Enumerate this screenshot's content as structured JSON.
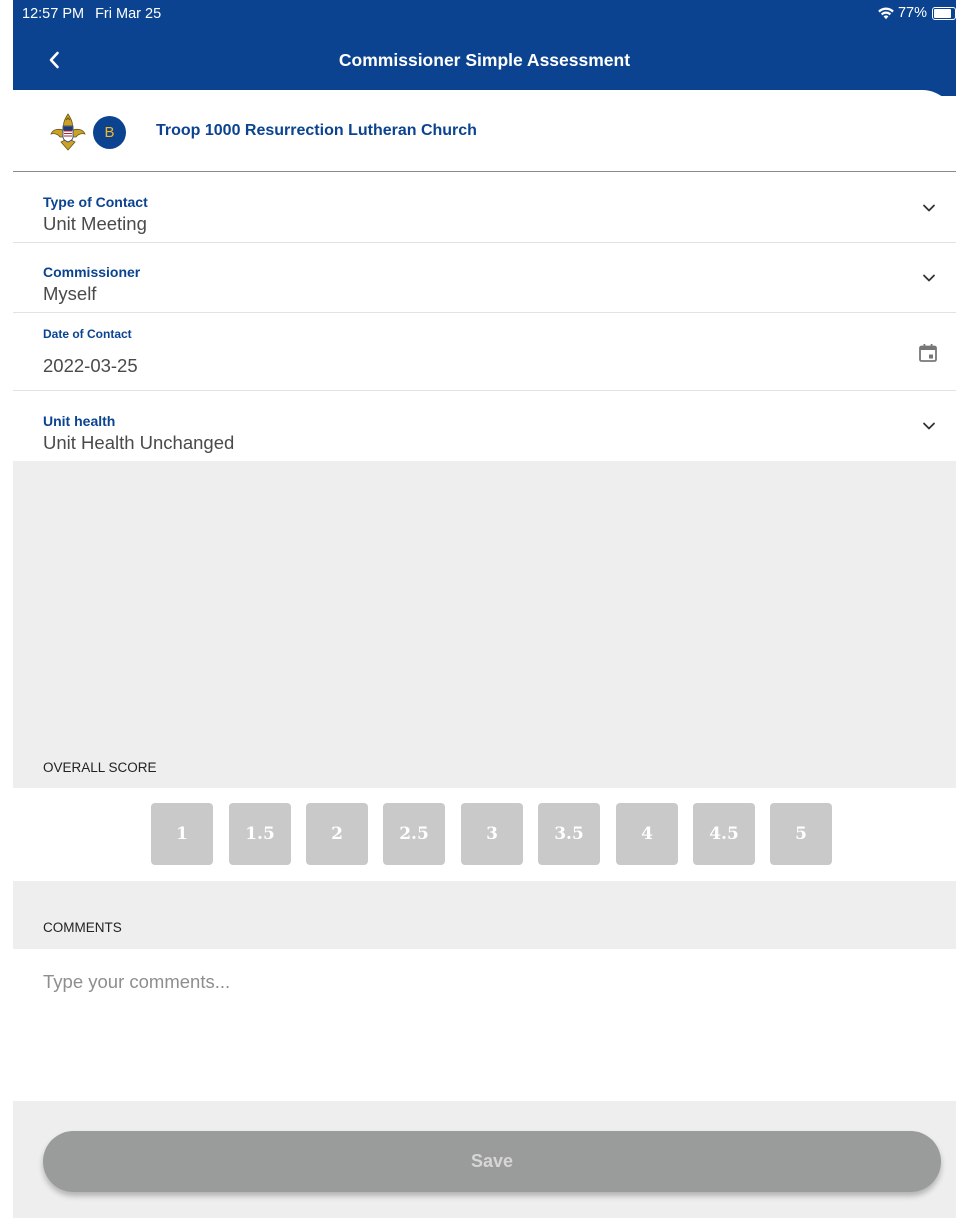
{
  "status_bar": {
    "time": "12:57 PM",
    "date": "Fri Mar 25",
    "battery": "77%"
  },
  "nav": {
    "title": "Commissioner Simple Assessment",
    "back_icon": "chevron-left-icon"
  },
  "unit": {
    "badge_letter": "B",
    "name": "Troop 1000 Resurrection Lutheran Church"
  },
  "fields": {
    "type_of_contact": {
      "label": "Type of Contact",
      "value": "Unit Meeting"
    },
    "commissioner": {
      "label": "Commissioner",
      "value": "Myself"
    },
    "date_of_contact": {
      "label": "Date of Contact",
      "value": "2022-03-25"
    },
    "unit_health": {
      "label": "Unit health",
      "value": "Unit Health Unchanged"
    }
  },
  "overall_score": {
    "label": "OVERALL SCORE",
    "options": [
      "1",
      "1.5",
      "2",
      "2.5",
      "3",
      "3.5",
      "4",
      "4.5",
      "5"
    ]
  },
  "comments": {
    "label": "COMMENTS",
    "placeholder": "Type your comments..."
  },
  "save_label": "Save",
  "colors": {
    "brand_blue": "#0b4390",
    "score_button": "#c9c9c9",
    "save_disabled": "#9a9b9b",
    "section_gray": "#eeeeee"
  }
}
